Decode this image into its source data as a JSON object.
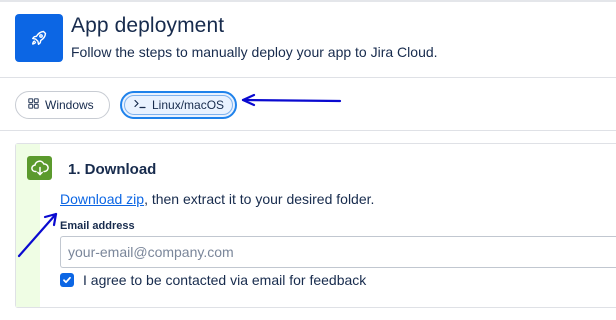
{
  "header": {
    "title": "App deployment",
    "subtitle": "Follow the steps to manually deploy your app to Jira Cloud.",
    "app_icon": "rocket-icon"
  },
  "tabs": [
    {
      "label": "Windows",
      "icon": "windows-icon",
      "selected": false
    },
    {
      "label": "Linux/macOS",
      "icon": "terminal-icon",
      "selected": true
    }
  ],
  "step": {
    "number_title": "1. Download",
    "icon": "cloud-download-icon",
    "link_text": "Download zip",
    "instruction_rest": ", then extract it to your desired folder.",
    "email": {
      "label": "Email address",
      "placeholder": "your-email@company.com",
      "value": ""
    },
    "consent": {
      "checked": true,
      "label": "I agree to be contacted via email for feedback"
    }
  },
  "colors": {
    "accent": "#0c66e4",
    "step_green": "#5b9a2d",
    "annotation_arrow": "#0a0ad0"
  }
}
